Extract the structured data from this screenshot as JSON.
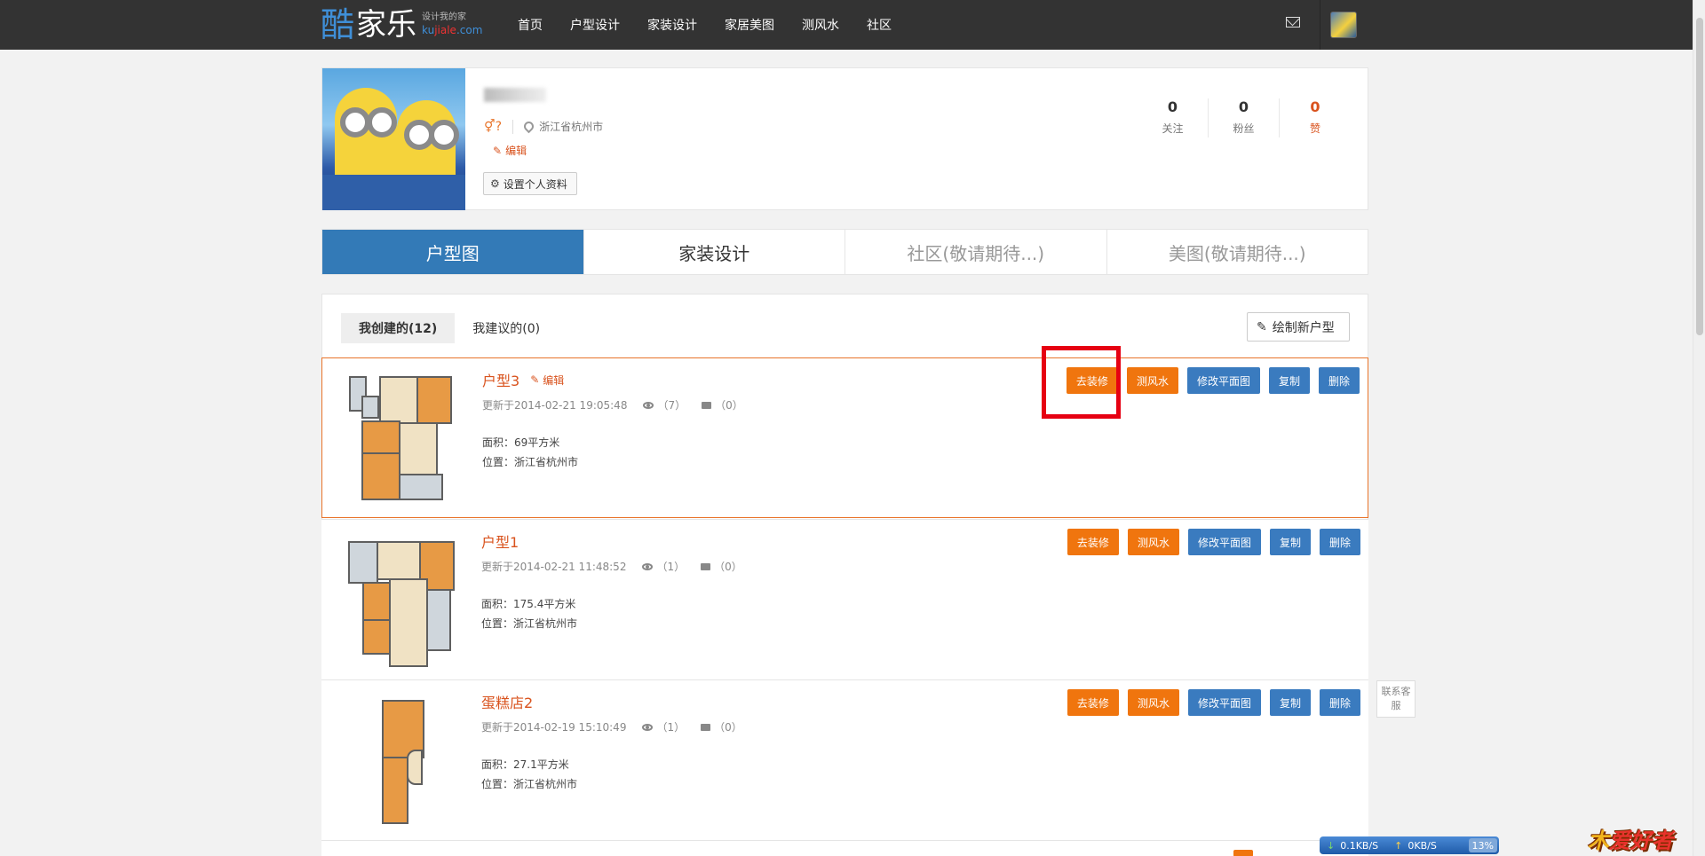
{
  "header": {
    "logo_ku": "酷",
    "logo_jiale": "家乐",
    "logo_tagline": "设计我的家",
    "logo_url_a": "ku",
    "logo_url_b": "jiale",
    "logo_url_c": ".com",
    "nav": [
      "首页",
      "户型设计",
      "家装设计",
      "家居美图",
      "测风水",
      "社区"
    ]
  },
  "profile": {
    "location": "浙江省杭州市",
    "gender_glyph": "⚥?",
    "edit_label": "编辑",
    "settings_label": "设置个人资料",
    "stats": [
      {
        "value": "0",
        "label": "关注"
      },
      {
        "value": "0",
        "label": "粉丝"
      },
      {
        "value": "0",
        "label": "赞"
      }
    ]
  },
  "tabs": [
    "户型图",
    "家装设计",
    "社区(敬请期待...)",
    "美图(敬请期待...)"
  ],
  "subtabs": [
    "我创建的(12)",
    "我建议的(0)"
  ],
  "draw_button": "绘制新户型",
  "item_labels": {
    "edit": "编辑",
    "area_prefix": "面积：",
    "location_prefix": "位置：",
    "actions": [
      "去装修",
      "测风水",
      "修改平面图",
      "复制",
      "删除"
    ]
  },
  "items": [
    {
      "title": "户型3",
      "has_edit": true,
      "updated": "更新于2014-02-21 19:05:48",
      "views": "（7）",
      "comments": "（0）",
      "area": "69平方米",
      "location": "浙江省杭州市"
    },
    {
      "title": "户型1",
      "has_edit": false,
      "updated": "更新于2014-02-21 11:48:52",
      "views": "（1）",
      "comments": "（0）",
      "area": "175.4平方米",
      "location": "浙江省杭州市"
    },
    {
      "title": "蛋糕店2",
      "has_edit": false,
      "updated": "更新于2014-02-19 15:10:49",
      "views": "（1）",
      "comments": "（0）",
      "area": "27.1平方米",
      "location": "浙江省杭州市"
    }
  ],
  "support_label": "联系客服",
  "netbar": {
    "down": "0.1KB/S",
    "up": "0KB/S",
    "percent": "13%"
  },
  "brand_badge_a": "木",
  "brand_badge_b": "爱好者",
  "colors": {
    "accent_blue": "#337ab7",
    "accent_orange": "#f0750e",
    "title_red": "#d9531e",
    "highlight": "#e60012"
  }
}
